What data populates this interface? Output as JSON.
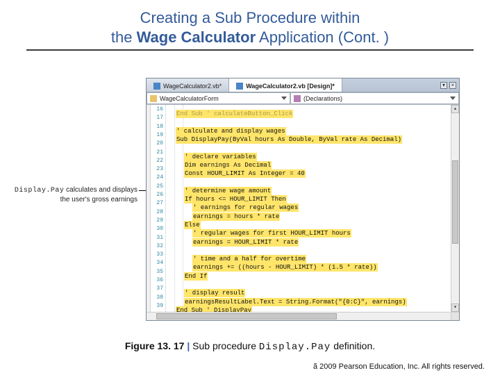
{
  "title": {
    "line1_pre": "Creating a ",
    "line1_sub": "Sub",
    "line1_post": " Procedure within",
    "line2_pre": "the ",
    "line2_app": "Wage Calculator",
    "line2_post": " Application (Cont. )"
  },
  "ide": {
    "tabs": [
      {
        "label": "WageCalculator2.vb*",
        "active": false
      },
      {
        "label": "WageCalculator2.vb [Design]*",
        "active": true
      }
    ],
    "combo_left": "WageCalculatorForm",
    "combo_right": "(Declarations)",
    "lines": [
      {
        "n": 16,
        "indent": 12,
        "text": "End Sub ' calculateButton_Click",
        "hl": true,
        "dim": true
      },
      {
        "n": 17,
        "indent": 0,
        "text": "",
        "hl": false
      },
      {
        "n": 18,
        "indent": 12,
        "text": "' calculate and display wages",
        "hl": true
      },
      {
        "n": 19,
        "indent": 12,
        "text": "Sub DisplayPay(ByVal hours As Double, ByVal rate As Decimal)",
        "hl": true
      },
      {
        "n": 20,
        "indent": 0,
        "text": "",
        "hl": false
      },
      {
        "n": 21,
        "indent": 24,
        "text": "' declare variables",
        "hl": true
      },
      {
        "n": 22,
        "indent": 24,
        "text": "Dim earnings As Decimal",
        "hl": true
      },
      {
        "n": 23,
        "indent": 24,
        "text": "Const HOUR_LIMIT As Integer = 40",
        "hl": true
      },
      {
        "n": 24,
        "indent": 0,
        "text": "",
        "hl": false
      },
      {
        "n": 25,
        "indent": 24,
        "text": "' determine wage amount",
        "hl": true
      },
      {
        "n": 26,
        "indent": 24,
        "text": "If hours <= HOUR_LIMIT Then",
        "hl": true
      },
      {
        "n": 27,
        "indent": 36,
        "text": "' earnings for regular wages",
        "hl": true
      },
      {
        "n": 28,
        "indent": 36,
        "text": "earnings = hours * rate",
        "hl": true
      },
      {
        "n": 29,
        "indent": 24,
        "text": "Else",
        "hl": true
      },
      {
        "n": 30,
        "indent": 36,
        "text": "' regular wages for first HOUR_LIMIT hours",
        "hl": true
      },
      {
        "n": 31,
        "indent": 36,
        "text": "earnings = HOUR_LIMIT * rate",
        "hl": true
      },
      {
        "n": 32,
        "indent": 0,
        "text": "",
        "hl": false
      },
      {
        "n": 33,
        "indent": 36,
        "text": "' time and a half for overtime",
        "hl": true
      },
      {
        "n": 34,
        "indent": 36,
        "text": "earnings += ((hours - HOUR_LIMIT) * (1.5 * rate))",
        "hl": true
      },
      {
        "n": 35,
        "indent": 24,
        "text": "End If",
        "hl": true
      },
      {
        "n": 36,
        "indent": 0,
        "text": "",
        "hl": false
      },
      {
        "n": 37,
        "indent": 24,
        "text": "' display result",
        "hl": true
      },
      {
        "n": 38,
        "indent": 24,
        "text": "earningsResultLabel.Text = String.Format(\"{0:C}\", earnings)",
        "hl": true
      },
      {
        "n": 39,
        "indent": 12,
        "text": "End Sub ' DisplayPay",
        "hl": true
      }
    ]
  },
  "callout": {
    "code_name": "Display.Pay",
    "text_rest": " calculates and displays the user's gross earnings"
  },
  "caption": {
    "fig": "Figure 13. 17",
    "pipe": " | ",
    "pre": "Sub procedure ",
    "code": "Display.Pay",
    "post": " definition."
  },
  "footer": "ã 2009 Pearson Education, Inc.  All rights reserved."
}
